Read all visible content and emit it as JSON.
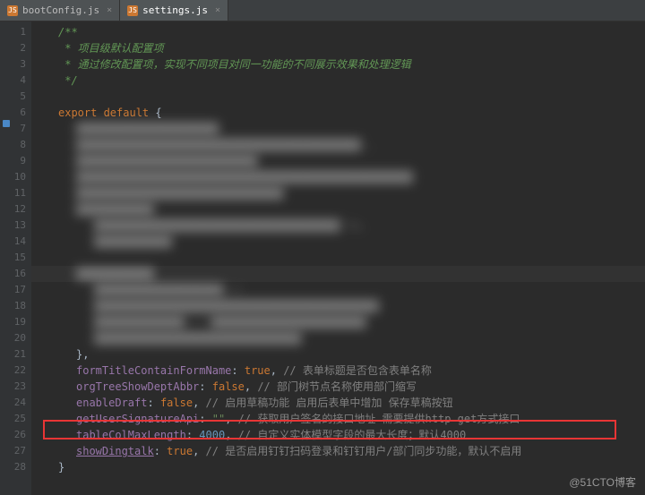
{
  "tabs": [
    {
      "icon": "JS",
      "label": "bootConfig.js",
      "close": "×"
    },
    {
      "icon": "JS",
      "label": "settings.js",
      "close": "×"
    }
  ],
  "gutter_lines": [
    "1",
    "2",
    "3",
    "4",
    "5",
    "6",
    "7",
    "8",
    "9",
    "10",
    "11",
    "12",
    "13",
    "14",
    "15",
    "16",
    "17",
    "18",
    "19",
    "20",
    "21",
    "22",
    "23",
    "24",
    "25",
    "26",
    "27",
    "28"
  ],
  "code": {
    "l1": "/**",
    "l2": " * 项目级默认配置项",
    "l3": " * 通过修改配置项，实现不同项目对同一功能的不同展示效果和处理逻辑",
    "l4": " */",
    "l6_export": "export ",
    "l6_default": "default ",
    "l6_brace": "{",
    "l21_brace": "},",
    "l22_prop": "formTitleContainFormName",
    "l22_val": "true",
    "l22_comment": "// 表单标题是否包含表单名称",
    "l23_prop": "orgTreeShowDeptAbbr",
    "l23_val": "false",
    "l23_comment": "// 部门树节点名称使用部门缩写",
    "l24_prop": "enableDraft",
    "l24_val": "false",
    "l24_comment": "// 启用草稿功能 启用后表单中增加 保存草稿按钮",
    "l25_prop": "getUserSignatureApi",
    "l25_val": "\"\"",
    "l25_comment": "// 获取用户签名的接口地址 需要提供http get方式接口",
    "l26_prop": "tableColMaxLength",
    "l26_val": "4000",
    "l26_comment": "// 自定义实体模型字段的最大长度；默认4000",
    "l27_prop": "showDingtalk",
    "l27_val": "true",
    "l27_comment": "// 是否启用钉钉扫码登录和钉钉用户/部门同步功能，默认不启用",
    "l28_brace": "}"
  },
  "blurred": {
    "b7": "██████████████████████",
    "b8": "████████████████████████████████████████████ ,",
    "b9": "████████████████████████████",
    "b10": "████████████████████████████████████████████████████",
    "b11": "████████████████████████████████",
    "b12": "████████████",
    "b13": "██████████████████████████████████████ le,",
    "b14": "████████████",
    "b16": "████████████",
    "b17": "████████████████████ //",
    "b18": "████████████████████████████████████████████",
    "b19": "██████████████ // ████████████████████████",
    "b20": "████████████████████████████████"
  },
  "watermark": "@51CTO博客"
}
